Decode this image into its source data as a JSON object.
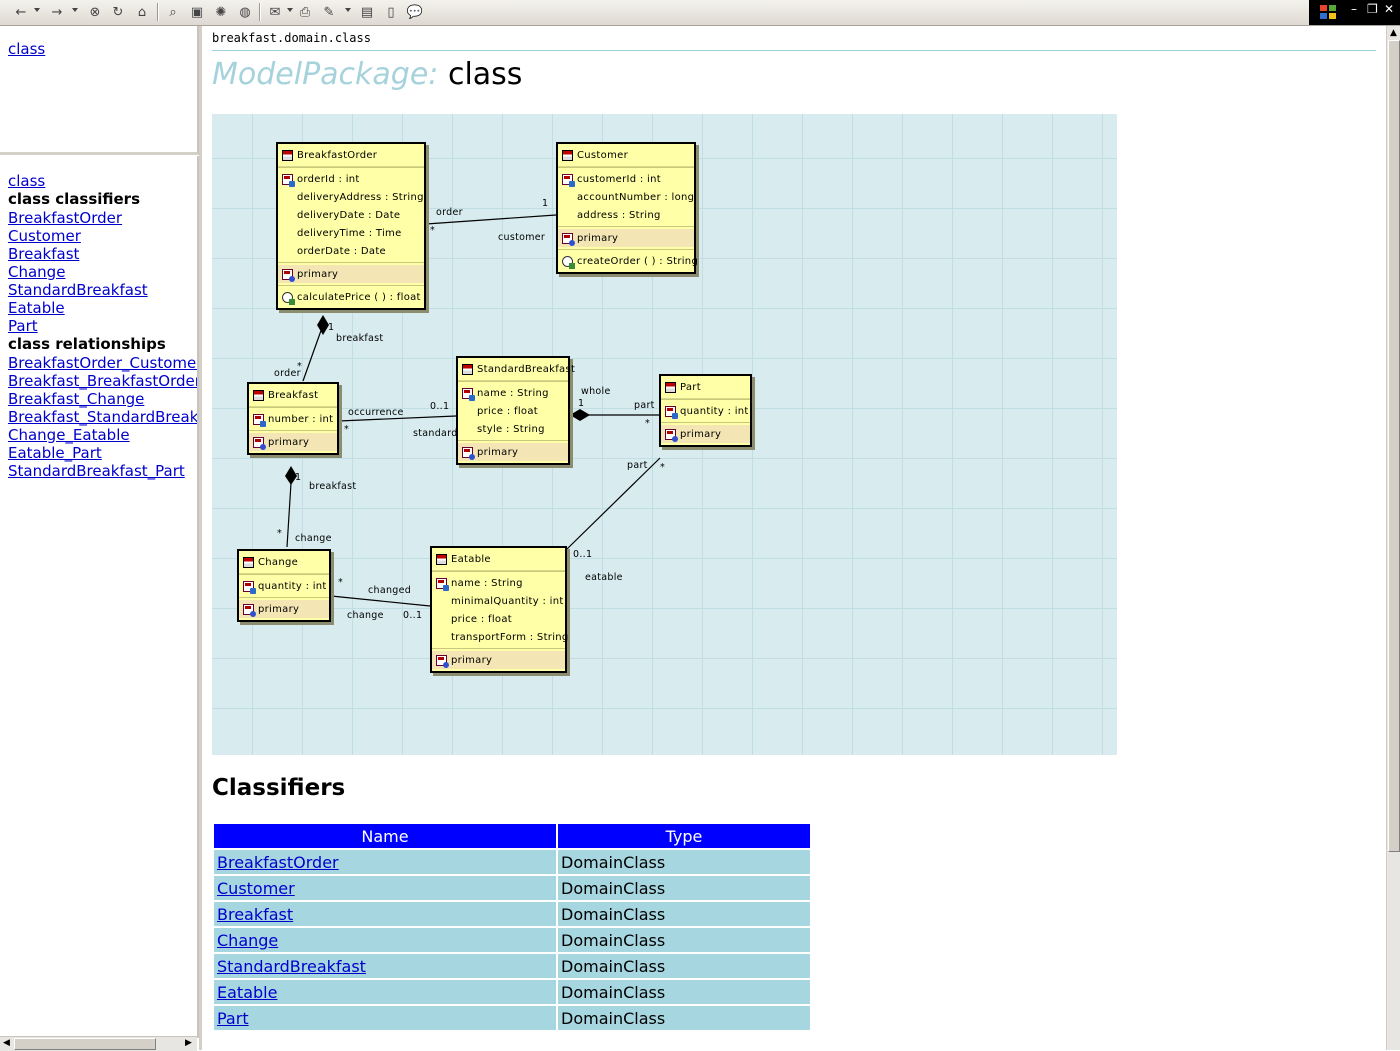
{
  "toolbar": {
    "icons": [
      "back-arrow-icon",
      "forward-arrow-icon",
      "stop-icon",
      "refresh-icon",
      "home-icon",
      "search-icon",
      "favorites-icon",
      "history-icon",
      "mail-icon",
      "edit-icon",
      "print-icon",
      "discuss-icon",
      "messenger-icon"
    ],
    "window_controls": {
      "minimize": "–",
      "restore": "❐",
      "close": "✕"
    }
  },
  "left_top": {
    "link": "class"
  },
  "left_nav": {
    "top_link": "class",
    "classifiers_heading": "class classifiers",
    "classifiers": [
      "BreakfastOrder",
      "Customer",
      "Breakfast",
      "Change",
      "StandardBreakfast",
      "Eatable",
      "Part"
    ],
    "relationships_heading": "class relationships",
    "relationships": [
      "BreakfastOrder_Customer",
      "Breakfast_BreakfastOrder",
      "Breakfast_Change",
      "Breakfast_StandardBreakfast",
      "Change_Eatable",
      "Eatable_Part",
      "StandardBreakfast_Part"
    ]
  },
  "main": {
    "package_path": "breakfast.domain.class",
    "title_prefix": "ModelPackage:",
    "title_name": "class"
  },
  "diagram": {
    "classes": {
      "breakfastorder": {
        "name": "BreakfastOrder",
        "attributes": [
          "orderId : int",
          "deliveryAddress : String",
          "deliveryDate : Date",
          "deliveryTime : Time",
          "orderDate : Date"
        ],
        "primary": "primary",
        "operations": [
          "calculatePrice ( ) : float"
        ]
      },
      "customer": {
        "name": "Customer",
        "attributes": [
          "customerId : int",
          "accountNumber : long",
          "address : String"
        ],
        "primary": "primary",
        "operations": [
          "createOrder ( ) : String"
        ]
      },
      "breakfast": {
        "name": "Breakfast",
        "attributes": [
          "number : int"
        ],
        "primary": "primary"
      },
      "standardbreakfast": {
        "name": "StandardBreakfast",
        "attributes": [
          "name : String",
          "price : float",
          "style : String"
        ],
        "primary": "primary"
      },
      "part": {
        "name": "Part",
        "attributes": [
          "quantity : int"
        ],
        "primary": "primary"
      },
      "change": {
        "name": "Change",
        "attributes": [
          "quantity : int"
        ],
        "primary": "primary"
      },
      "eatable": {
        "name": "Eatable",
        "attributes": [
          "name : String",
          "minimalQuantity : int",
          "price : float",
          "transportForm : String"
        ],
        "primary": "primary"
      }
    },
    "labels": {
      "bo_cust_order": "order",
      "bo_cust_star": "*",
      "bo_cust_one": "1",
      "bo_cust_customer": "customer",
      "bo_bf_one": "1",
      "bo_bf_breakfast": "breakfast",
      "bo_bf_star": "*",
      "bo_bf_order": "order",
      "bf_sb_occurrence": "occurrence",
      "bf_sb_star": "*",
      "bf_sb_01": "0..1",
      "bf_sb_standard": "standard",
      "sb_part_whole": "whole",
      "sb_part_one": "1",
      "sb_part_part": "part",
      "sb_part_star": "*",
      "eat_part_part": "part",
      "eat_part_star": "*",
      "eat_part_01": "0..1",
      "eat_part_eatable": "eatable",
      "bf_ch_one": "1",
      "bf_ch_breakfast": "breakfast",
      "bf_ch_star": "*",
      "bf_ch_change": "change",
      "ch_eat_star": "*",
      "ch_eat_changed": "changed",
      "ch_eat_change": "change",
      "ch_eat_01": "0..1"
    }
  },
  "classifiers": {
    "heading": "Classifiers",
    "columns": [
      "Name",
      "Type"
    ],
    "rows": [
      {
        "name": "BreakfastOrder",
        "type": "DomainClass"
      },
      {
        "name": "Customer",
        "type": "DomainClass"
      },
      {
        "name": "Breakfast",
        "type": "DomainClass"
      },
      {
        "name": "Change",
        "type": "DomainClass"
      },
      {
        "name": "StandardBreakfast",
        "type": "DomainClass"
      },
      {
        "name": "Eatable",
        "type": "DomainClass"
      },
      {
        "name": "Part",
        "type": "DomainClass"
      }
    ]
  }
}
